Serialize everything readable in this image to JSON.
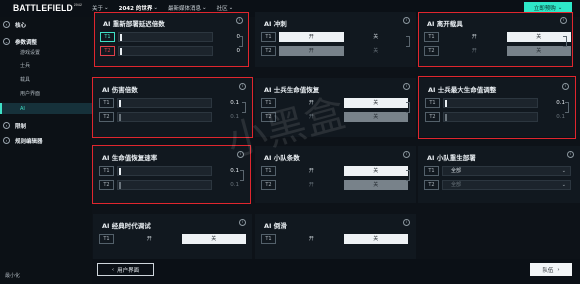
{
  "topbar": {
    "logo": "BATTLEFIELD",
    "logo_sub": "2042",
    "nav": [
      {
        "label": "关于",
        "bold": false
      },
      {
        "label": "2042 的世界",
        "bold": true
      },
      {
        "label": "最新媒体消息",
        "bold": false
      },
      {
        "label": "社区",
        "bold": false
      }
    ],
    "buy_label": "立即预购"
  },
  "sidebar": {
    "items": [
      {
        "label": "核心",
        "type": "main"
      },
      {
        "label": "参数调整",
        "type": "main"
      },
      {
        "label": "游戏设置",
        "type": "sub"
      },
      {
        "label": "士兵",
        "type": "sub"
      },
      {
        "label": "载具",
        "type": "sub"
      },
      {
        "label": "用户界面",
        "type": "sub"
      },
      {
        "label": "AI",
        "type": "sub"
      },
      {
        "label": "限制",
        "type": "main"
      },
      {
        "label": "规则编辑器",
        "type": "main"
      }
    ],
    "footer": "最小化"
  },
  "cards": [
    {
      "title": "AI 重新部署延迟倍数",
      "kind": "slider",
      "rows": [
        {
          "tag": "T1",
          "value": "0",
          "dim": false
        },
        {
          "tag": "T2",
          "value": "0",
          "dim": false
        }
      ]
    },
    {
      "title": "AI 冲刺",
      "kind": "toggle",
      "rows": [
        {
          "tag": "T1",
          "a": "开",
          "b": "关",
          "sel": 0,
          "dim": false
        },
        {
          "tag": "T2",
          "a": "开",
          "b": "关",
          "sel": 0,
          "dim": true
        }
      ]
    },
    {
      "title": "AI 离开载具",
      "kind": "toggle",
      "rows": [
        {
          "tag": "T1",
          "a": "开",
          "b": "关",
          "sel": 1,
          "dim": false
        },
        {
          "tag": "T2",
          "a": "开",
          "b": "关",
          "sel": 1,
          "dim": true
        }
      ]
    },
    {
      "title": "AI 伤害倍数",
      "kind": "slider",
      "rows": [
        {
          "tag": "T1",
          "value": "0.1",
          "dim": false
        },
        {
          "tag": "T2",
          "value": "0.1",
          "dim": true
        }
      ]
    },
    {
      "title": "AI 士兵生命值恢复",
      "kind": "toggle",
      "rows": [
        {
          "tag": "T1",
          "a": "开",
          "b": "关",
          "sel": 1,
          "dim": false
        },
        {
          "tag": "T2",
          "a": "开",
          "b": "关",
          "sel": 1,
          "dim": true
        }
      ]
    },
    {
      "title": "AI 士兵最大生命值调整",
      "kind": "slider",
      "rows": [
        {
          "tag": "T1",
          "value": "0.1",
          "dim": false
        },
        {
          "tag": "T2",
          "value": "0.1",
          "dim": true
        }
      ]
    },
    {
      "title": "AI 生命值恢复速率",
      "kind": "slider",
      "rows": [
        {
          "tag": "T1",
          "value": "0.1",
          "dim": false
        },
        {
          "tag": "T2",
          "value": "0.1",
          "dim": true
        }
      ]
    },
    {
      "title": "AI 小队条数",
      "kind": "toggle",
      "rows": [
        {
          "tag": "T1",
          "a": "开",
          "b": "关",
          "sel": 1,
          "dim": false
        },
        {
          "tag": "T2",
          "a": "开",
          "b": "关",
          "sel": 1,
          "dim": true
        }
      ]
    },
    {
      "title": "AI 小队重生部署",
      "kind": "dropdown",
      "rows": [
        {
          "tag": "T1",
          "value": "全部",
          "dim": false
        },
        {
          "tag": "T2",
          "value": "全部",
          "dim": true
        }
      ]
    },
    {
      "title": "AI 经典时代调试",
      "kind": "toggle",
      "rows": [
        {
          "tag": "T1",
          "a": "开",
          "b": "关",
          "sel": 1,
          "dim": false
        }
      ]
    },
    {
      "title": "AI 倒滑",
      "kind": "toggle",
      "rows": [
        {
          "tag": "T1",
          "a": "开",
          "b": "关",
          "sel": 1,
          "dim": false
        }
      ]
    }
  ],
  "bottom": {
    "user_ui_label": "用户界面",
    "squad_label": "队伍"
  },
  "watermark": "小黑盒",
  "colors": {
    "accent": "#3fe0c6",
    "buy": "#2ee8c8",
    "highlight": "#e0262e"
  }
}
